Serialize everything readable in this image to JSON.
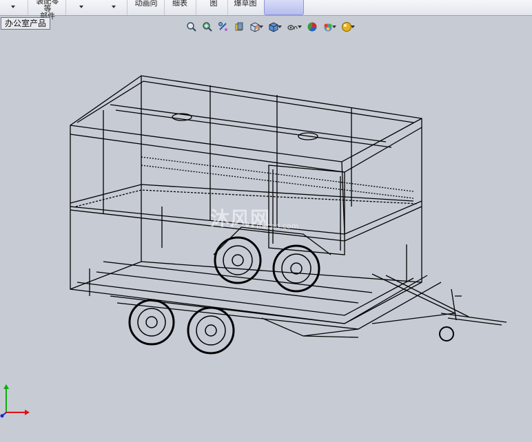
{
  "ribbon": {
    "assembly_label_top": "装配零等",
    "assembly_label": "部件",
    "animation_label": "动画向",
    "bom_label": "细表",
    "drawing_label": "图",
    "explode_label": "爆草图"
  },
  "tree_tab": {
    "label": "办公室产品"
  },
  "view_toolbar": {
    "icons": [
      "zoom-to-fit-icon",
      "zoom-to-area-icon",
      "previous-view-icon",
      "section-view-icon",
      "view-orientation-icon",
      "display-style-icon",
      "hide-show-items-icon",
      "edit-appearance-icon",
      "apply-scene-icon",
      "view-settings-icon"
    ]
  },
  "model": {
    "description": "trailer-wireframe"
  },
  "watermark": {
    "text": "沐风网",
    "sub": "mfcad.com"
  },
  "colors": {
    "viewport_bg": "#c6cbd4",
    "wire": "#000000",
    "triad_x": "#d11",
    "triad_y": "#1a1",
    "triad_z": "#22c"
  }
}
